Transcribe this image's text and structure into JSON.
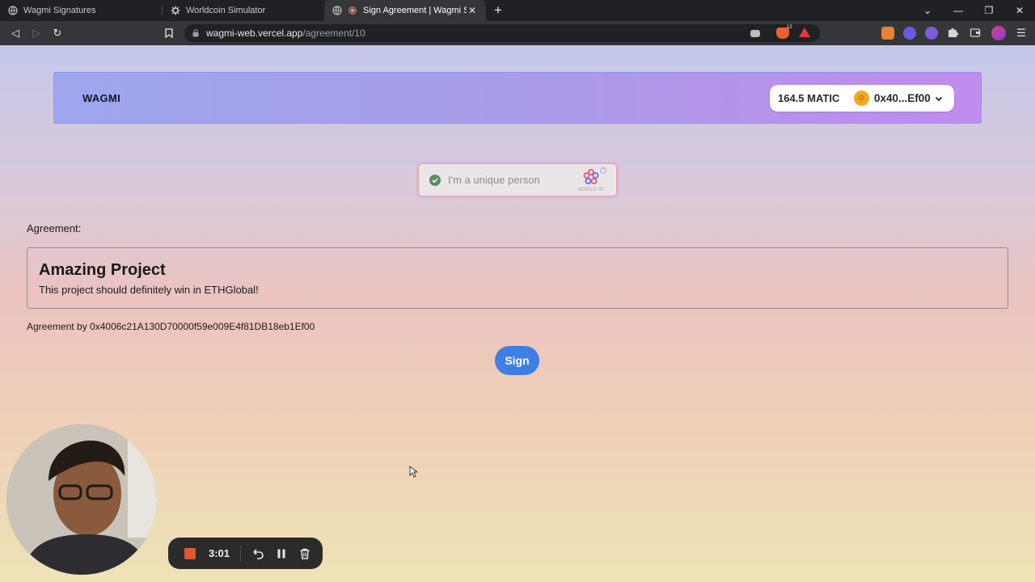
{
  "browser": {
    "tabs": [
      {
        "title": "Wagmi Signatures",
        "active": false
      },
      {
        "title": "Worldcoin Simulator",
        "active": false
      },
      {
        "title": "Sign Agreement | Wagmi Signa",
        "active": true
      }
    ],
    "url_host": "wagmi-web.vercel.app",
    "url_path": "/agreement/10",
    "shield_count": "12"
  },
  "header": {
    "brand": "WAGMI",
    "balance": "164.5 MATIC",
    "account": "0x40...Ef00"
  },
  "worldid": {
    "label": "I'm a unique person",
    "badge": "WORLD ID"
  },
  "agreement": {
    "label": "Agreement:",
    "title": "Amazing Project",
    "body": "This project should definitely win in ETHGlobal!",
    "by": "Agreement by 0x4006c21A130D70000f59e009E4f81DB18eb1Ef00"
  },
  "actions": {
    "sign_label": "Sign"
  },
  "recorder": {
    "elapsed": "3:01"
  },
  "colors": {
    "accent": "#3f7fe3",
    "header_start": "#9ea6ee",
    "header_end": "#c18cee",
    "record": "#e0592c"
  }
}
